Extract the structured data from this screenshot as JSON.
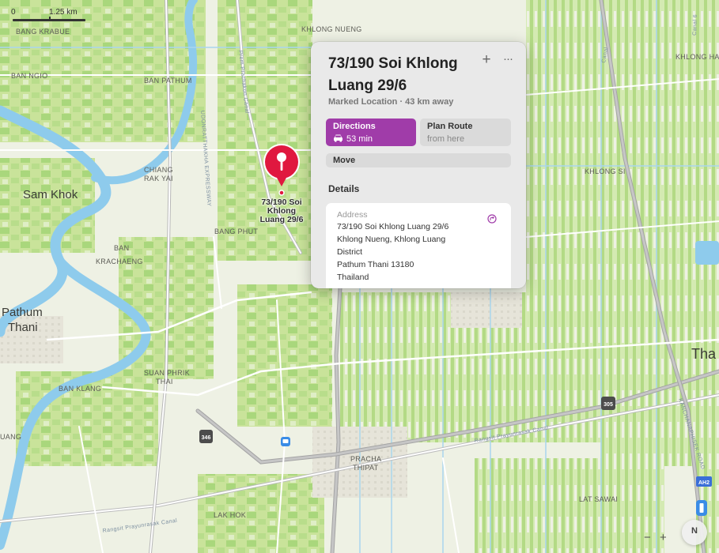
{
  "scale": {
    "zero": "0",
    "distance": "1.25 km"
  },
  "map_labels": {
    "bang_krabue": "BANG KRABUE",
    "ban_ngio": "BAN NGIO",
    "ban_pathum": "BAN PATHUM",
    "chiang_rak_yai": [
      "CHIANG",
      "RAK YAI"
    ],
    "sam_khok": "Sam Khok",
    "bang_phut": "BANG PHUT",
    "ban_krachaeng": [
      "BAN",
      "KRACHAENG"
    ],
    "pathum_thani": [
      "Pathum",
      "Thani"
    ],
    "suan_phrik_thai": [
      "SUAN PHRIK",
      "THAI"
    ],
    "ban_klang": "BAN KLANG",
    "uang": "UANG",
    "pracha_thipat": [
      "PRACHA",
      "THIPAT"
    ],
    "lak_hok": "LAK HOK",
    "khlong_nueng": "KHLONG NUENG",
    "khlong_ha": "KHLONG HA",
    "khlong_si": "KHLONG SI",
    "lat_sawai": "LAT SAWAI",
    "tha": "Tha",
    "road_prem_prachakon": "Prem Prachakon Canal",
    "road_udon": "UDONRATTHAKHA EXPRESSWAY",
    "road_rangsit_1": "Rangsit Prayunrasak Canal",
    "road_rangsit_2": "Rangsit Prayunrasak Canal",
    "road_kanchana": "KANCHANAPHISEK ROAD",
    "road_canal": "Canal",
    "road_canal_6": "Canal 6",
    "shield_346": "346",
    "shield_305": "305",
    "shield_ah2": "AH2"
  },
  "pin": {
    "label": [
      "73/190 Soi",
      "Khlong",
      "Luang 29/6"
    ],
    "color": "#e0183f"
  },
  "card": {
    "title": "73/190 Soi Khlong Luang 29/6",
    "subtitle": "Marked Location · 43 km away",
    "add_icon": "+",
    "more_icon": "···",
    "directions": {
      "label": "Directions",
      "time": "53 min",
      "color": "#a03ca9"
    },
    "plan_route": {
      "label": "Plan Route",
      "sub": "from here"
    },
    "move_label": "Move",
    "details_heading": "Details",
    "address": {
      "caption": "Address",
      "lines": [
        "73/190 Soi Khlong Luang 29/6",
        "Khlong Nueng, Khlong Luang",
        "District",
        "Pathum Thani 13180",
        "Thailand"
      ]
    }
  },
  "controls": {
    "zoom_out": "−",
    "zoom_in": "+",
    "compass": "N"
  }
}
